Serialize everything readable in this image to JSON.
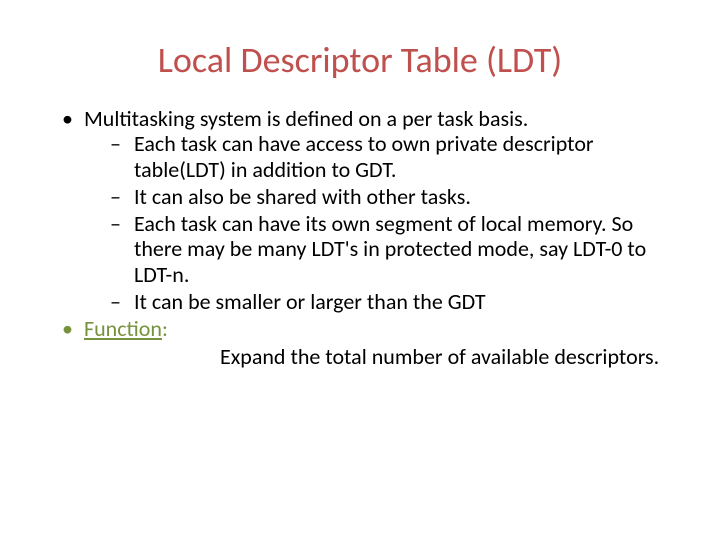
{
  "title": "Local Descriptor Table (LDT)",
  "b1": "Multitasking system is defined on a per task basis.",
  "s1": "Each task can have access to own private descriptor table(LDT) in addition to GDT.",
  "s2": "It can also be shared with other tasks.",
  "s3": "Each task can have its own segment of local memory. So there may be many LDT's in protected mode, say LDT-0 to LDT-n.",
  "s4": "It can be smaller or larger than the GDT",
  "func_label": "Function",
  "func_colon": ":",
  "func_text": "Expand the total number of available descriptors."
}
